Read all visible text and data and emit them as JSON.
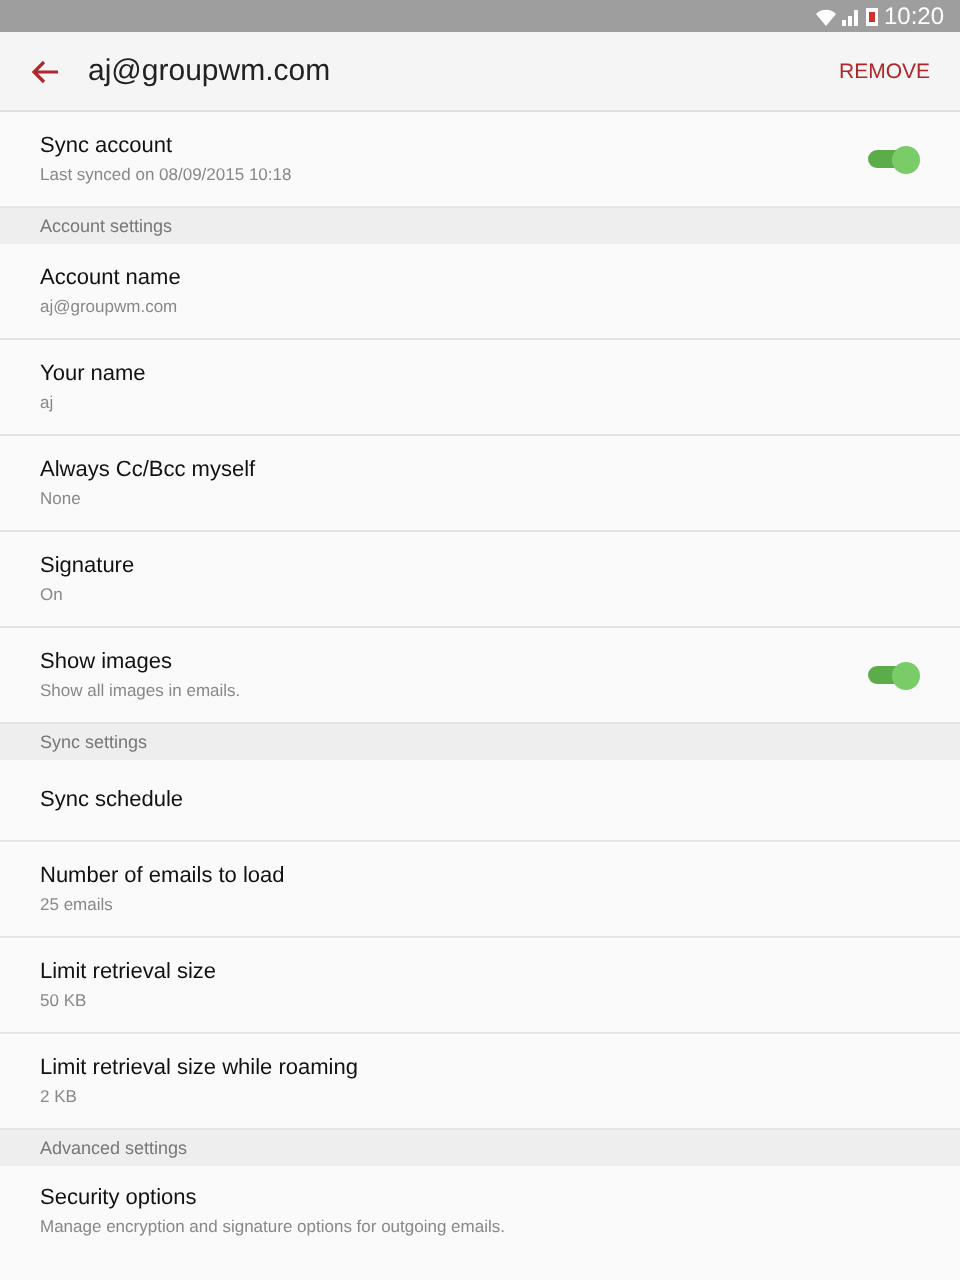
{
  "status_bar": {
    "time": "10:20"
  },
  "header": {
    "title": "aj@groupwm.com",
    "action": "REMOVE"
  },
  "items": [
    {
      "kind": "switch",
      "title": "Sync account",
      "subtitle": "Last synced on 08/09/2015 10:18",
      "on": true
    },
    {
      "kind": "header",
      "title": "Account settings"
    },
    {
      "kind": "setting",
      "title": "Account name",
      "subtitle": "aj@groupwm.com"
    },
    {
      "kind": "setting",
      "title": "Your name",
      "subtitle": "aj"
    },
    {
      "kind": "setting",
      "title": "Always Cc/Bcc myself",
      "subtitle": "None"
    },
    {
      "kind": "setting",
      "title": "Signature",
      "subtitle": "On"
    },
    {
      "kind": "switch",
      "title": "Show images",
      "subtitle": "Show all images in emails.",
      "on": true
    },
    {
      "kind": "header",
      "title": "Sync settings"
    },
    {
      "kind": "setting",
      "title": "Sync schedule"
    },
    {
      "kind": "setting",
      "title": "Number of emails to load",
      "subtitle": "25 emails"
    },
    {
      "kind": "setting",
      "title": "Limit retrieval size",
      "subtitle": "50 KB"
    },
    {
      "kind": "setting",
      "title": "Limit retrieval size while roaming",
      "subtitle": "2 KB"
    },
    {
      "kind": "header",
      "title": "Advanced settings"
    },
    {
      "kind": "setting",
      "title": "Security options",
      "subtitle": "Manage encryption and signature options for outgoing emails."
    }
  ]
}
